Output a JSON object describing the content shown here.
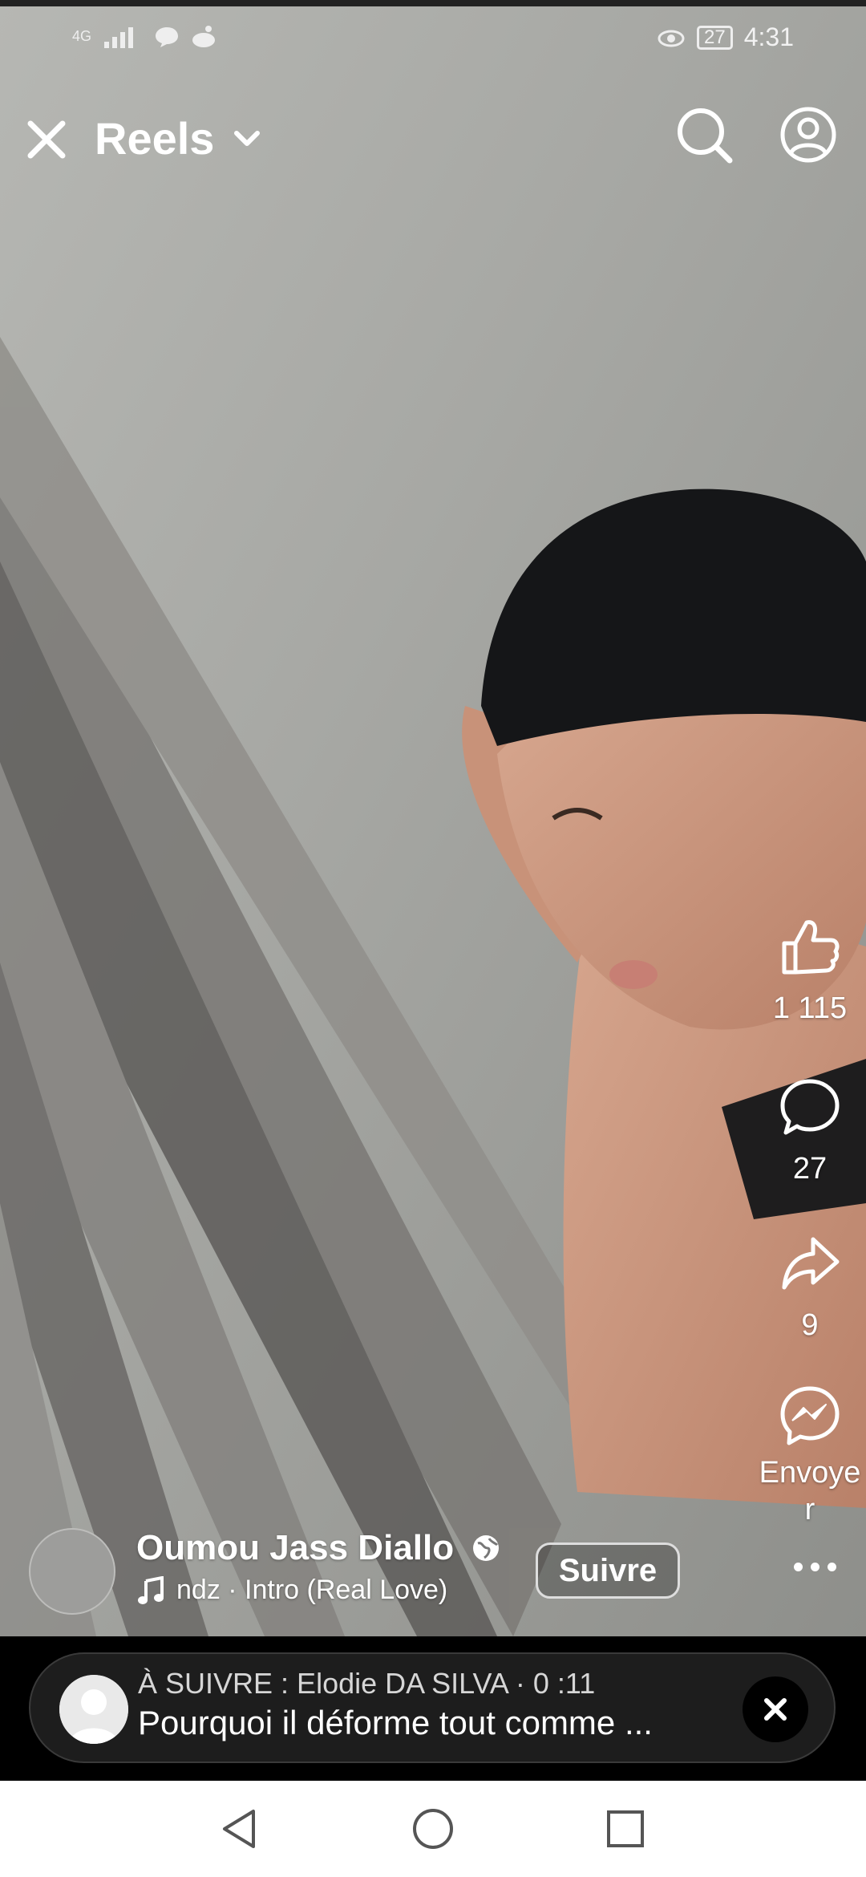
{
  "status_bar": {
    "network": "4G",
    "battery": "27",
    "time": "4:31"
  },
  "header": {
    "title": "Reels"
  },
  "actions": {
    "likes": "1 115",
    "comments": "27",
    "shares": "9",
    "send_label": "Envoye r"
  },
  "author": {
    "name": "Oumou Jass Diallo",
    "music": "ndz · Intro (Real Love)",
    "follow_label": "Suivre"
  },
  "up_next": {
    "line1": "À SUIVRE : Elodie DA SILVA · 0 :11",
    "line2": "Pourquoi il déforme tout comme ..."
  }
}
